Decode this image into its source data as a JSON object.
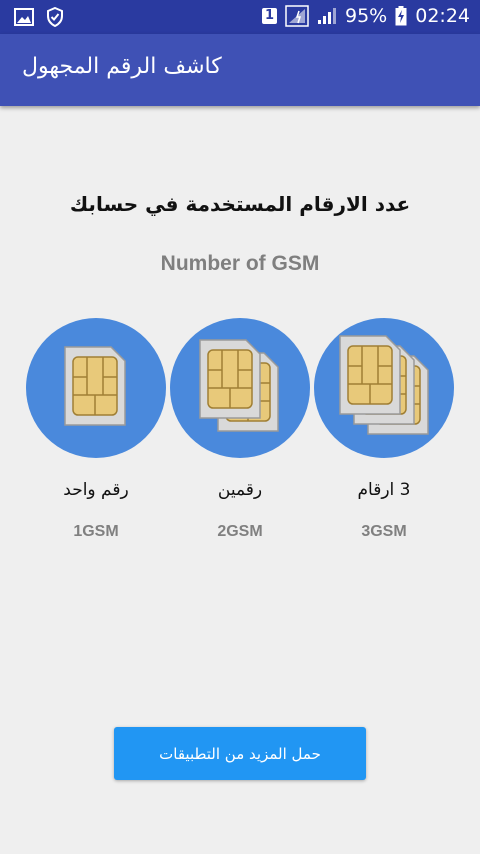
{
  "status_bar": {
    "icons_left": [
      "image-icon",
      "shield-check-icon"
    ],
    "sim_slot": "1",
    "icons_right": [
      "sim-signal-icon",
      "signal-icon"
    ],
    "battery_percent": "95%",
    "time": "02:24"
  },
  "app_bar": {
    "title": "كاشف الرقم المجهول"
  },
  "main": {
    "heading": "عدد الارقام المستخدمة في حسابك",
    "subheading": "Number of GSM"
  },
  "options": [
    {
      "label": "رقم واحد",
      "code": "1GSM",
      "sim_count": 1
    },
    {
      "label": "رقمين",
      "code": "2GSM",
      "sim_count": 2
    },
    {
      "label": "3 ارقام",
      "code": "3GSM",
      "sim_count": 3
    }
  ],
  "footer": {
    "more_apps_label": "حمل المزيد من التطبيقات"
  },
  "colors": {
    "status_bar": "#2a3aa0",
    "app_bar": "#3f51b5",
    "circle": "#4a89dc",
    "button": "#2196f3",
    "background": "#efefef"
  }
}
